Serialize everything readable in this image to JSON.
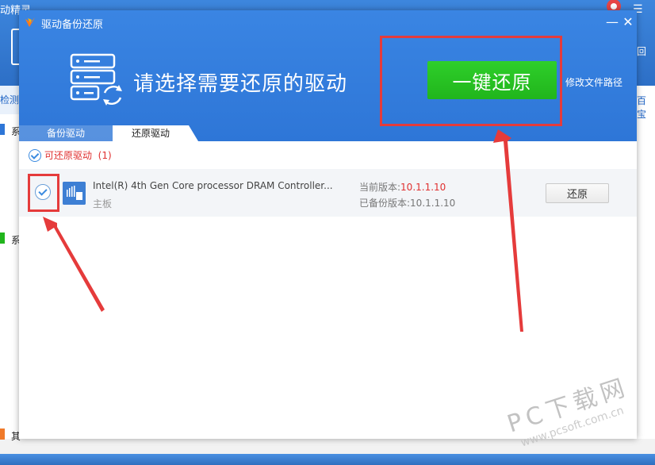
{
  "background_app": {
    "title": "动精灵",
    "side_tab": "检测",
    "side_item_1": "系",
    "side_item_2": "系",
    "bottom_item": "其",
    "right_text_1": "回",
    "right_text_2": "百宝"
  },
  "window": {
    "title": "驱动备份还原",
    "minimize": "—",
    "close": "✕"
  },
  "header": {
    "prompt": "请选择需要还原的驱动",
    "restore_all": "一键还原",
    "change_path": "修改文件路径"
  },
  "tabs": [
    {
      "label": "备份驱动"
    },
    {
      "label": "还原驱动"
    }
  ],
  "section": {
    "title": "可还原驱动",
    "count": "(1)"
  },
  "drivers": [
    {
      "name": "Intel(R) 4th Gen Core processor DRAM Controller...",
      "category": "主板",
      "current_label": "当前版本:",
      "current_version": "10.1.1.10",
      "backup_label": "已备份版本:",
      "backup_version": "10.1.1.10",
      "restore_label": "还原"
    }
  ],
  "watermark": {
    "text": "PC下载网",
    "url": "www.pcsoft.com.cn"
  },
  "colors": {
    "header_blue": "#2e76d7",
    "green_button": "#21b51c",
    "highlight_red": "#e53b3b",
    "version_red": "#e03030"
  }
}
